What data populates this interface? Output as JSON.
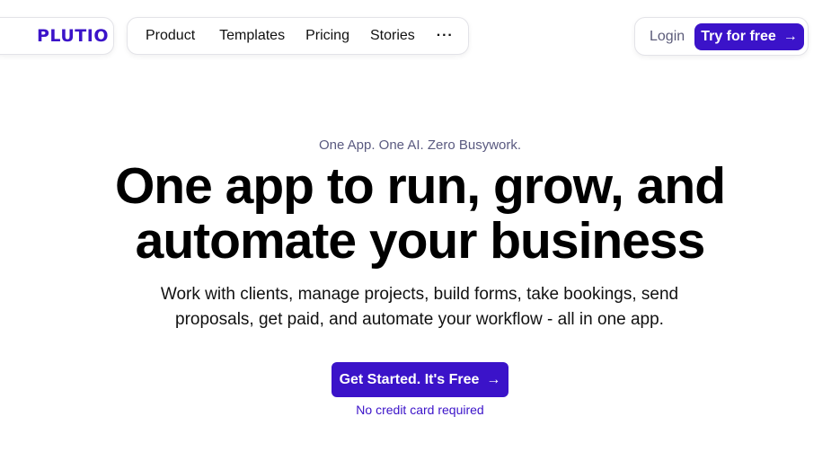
{
  "brand": {
    "logo_text": "PLUTIO",
    "accent_color": "#3b13c9"
  },
  "nav": {
    "items": [
      {
        "label": "Product"
      },
      {
        "label": "Templates"
      },
      {
        "label": "Pricing"
      },
      {
        "label": "Stories"
      }
    ],
    "more_label": "···",
    "more_icon": "more-dots-icon"
  },
  "auth": {
    "login_label": "Login",
    "try_label": "Try for free",
    "arrow": "→"
  },
  "hero": {
    "eyebrow": "One App. One AI. Zero Busywork.",
    "headline_line1": "One app to run, grow, and",
    "headline_line2": "automate your business",
    "subtext_line1": "Work with clients, manage projects, build forms, take bookings, send",
    "subtext_line2": "proposals, get paid, and automate your workflow - all in one app.",
    "cta_label": "Get Started. It's Free",
    "cta_arrow": "→",
    "note": "No credit card required"
  }
}
